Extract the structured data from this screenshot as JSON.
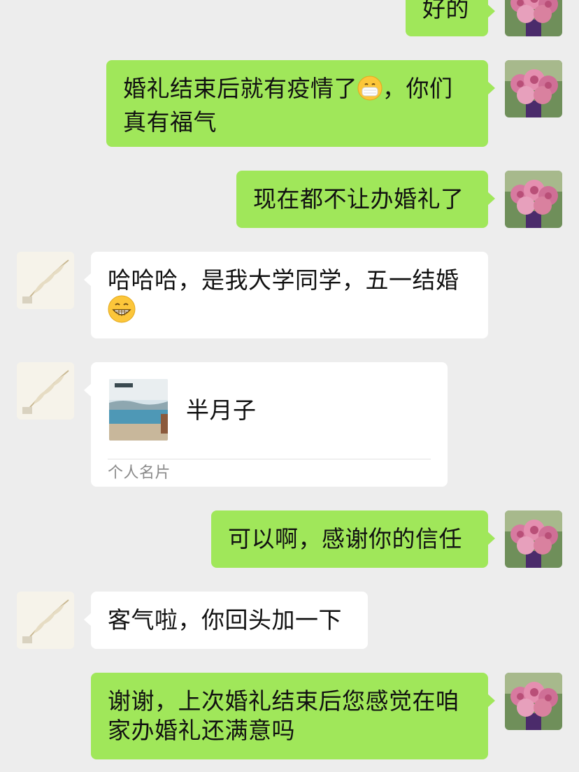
{
  "messages": [
    {
      "side": "me",
      "text": "好的"
    },
    {
      "side": "me",
      "text_before": "婚礼结束后就有疫情了",
      "emoji": "mask-face-emoji",
      "text_after": "，你们真有福气",
      "line1_after": "，你们",
      "line2": "真有福气"
    },
    {
      "side": "me",
      "text": "现在都不让办婚礼了"
    },
    {
      "side": "them",
      "text": "哈哈哈，是我大学同学，五一结婚",
      "emoji": "grin-emoji"
    },
    {
      "side": "them",
      "type": "contact-card",
      "card_name": "半月子",
      "card_type": "个人名片"
    },
    {
      "side": "me",
      "text": "可以啊，感谢你的信任"
    },
    {
      "side": "them",
      "text": "客气啦，你回头加一下"
    },
    {
      "side": "me",
      "line1": "谢谢，上次婚礼结束后您感觉在咱",
      "line2": "家办婚礼还满意吗"
    }
  ],
  "colors": {
    "background": "#ededed",
    "my_bubble": "#a0e75a",
    "their_bubble": "#ffffff"
  },
  "icons": {
    "my_avatar": "rose-bouquet-avatar",
    "their_avatar": "feather-avatar"
  }
}
